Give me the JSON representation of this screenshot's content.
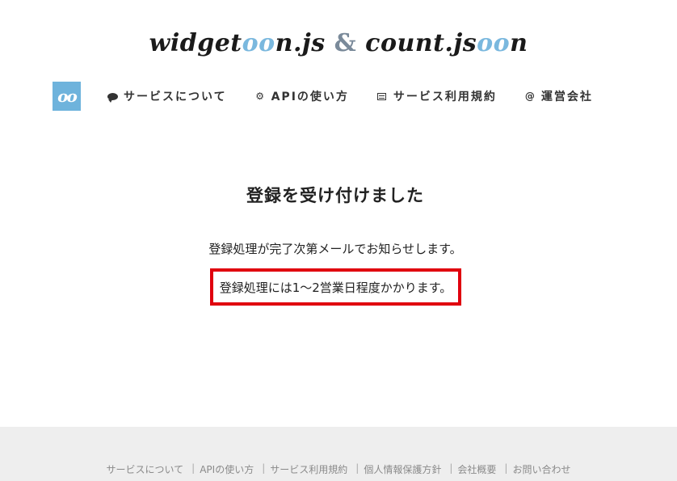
{
  "header": {
    "logo": {
      "part1": "widget",
      "oo1": "oo",
      "part2": "n.js",
      "amp": "&",
      "part3": "count.js",
      "oo2": "oo",
      "part4": "n"
    },
    "nav_logo": "oo"
  },
  "nav": {
    "items": [
      {
        "label": "サービスについて",
        "icon": "speech-bubble-icon"
      },
      {
        "label": "APIの使い方",
        "icon": "gear-icon"
      },
      {
        "label": "サービス利用規約",
        "icon": "document-icon"
      },
      {
        "label": "運営会社",
        "icon": "at-icon"
      }
    ]
  },
  "main": {
    "title": "登録を受け付けました",
    "message1": "登録処理が完了次第メールでお知らせします。",
    "message2": "登録処理には1～2営業日程度かかります。"
  },
  "footer": {
    "links": [
      "サービスについて",
      "APIの使い方",
      "サービス利用規約",
      "個人情報保護方針",
      "会社概要",
      "お問い合わせ"
    ],
    "separator": "|"
  },
  "colors": {
    "accent": "#6eb3dc",
    "highlight_border": "#e0000e",
    "footer_bg": "#eeeeee"
  }
}
